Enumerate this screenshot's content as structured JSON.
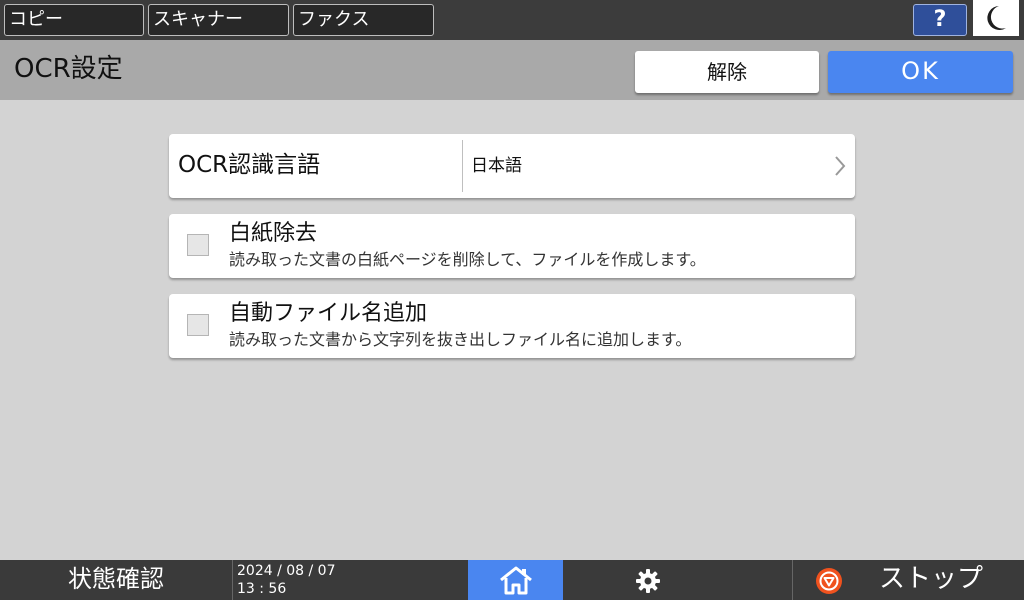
{
  "top_bar": {
    "tabs": [
      {
        "label": "コピー"
      },
      {
        "label": "スキャナー"
      },
      {
        "label": "ファクス"
      }
    ],
    "help_label": "?",
    "sleep_icon": "moon-icon"
  },
  "header": {
    "title": "OCR設定",
    "cancel_label": "解除",
    "ok_label": "OK"
  },
  "settings": {
    "ocr_language": {
      "label": "OCR認識言語",
      "value": "日本語",
      "icon": "chevron-right-icon"
    },
    "blank_page_removal": {
      "title": "白紙除去",
      "description": "読み取った文書の白紙ページを削除して、ファイルを作成します。",
      "checked": false
    },
    "auto_file_name": {
      "title": "自動ファイル名追加",
      "description": "読み取った文書から文字列を抜き出しファイル名に追加します。",
      "checked": false
    }
  },
  "bottom_bar": {
    "status_check_label": "状態確認",
    "date": "2024 / 08 / 07",
    "time": "13 : 56",
    "home_icon": "home-icon",
    "settings_icon": "gear-icon",
    "stop_icon": "stop-icon",
    "stop_label": "ストップ"
  },
  "colors": {
    "accent_blue": "#4a86f0",
    "background_gray": "#d3d3d3",
    "header_gray": "#a9a9a9",
    "top_bar": "#3c3c3c",
    "stop_orange": "#f0521e"
  }
}
